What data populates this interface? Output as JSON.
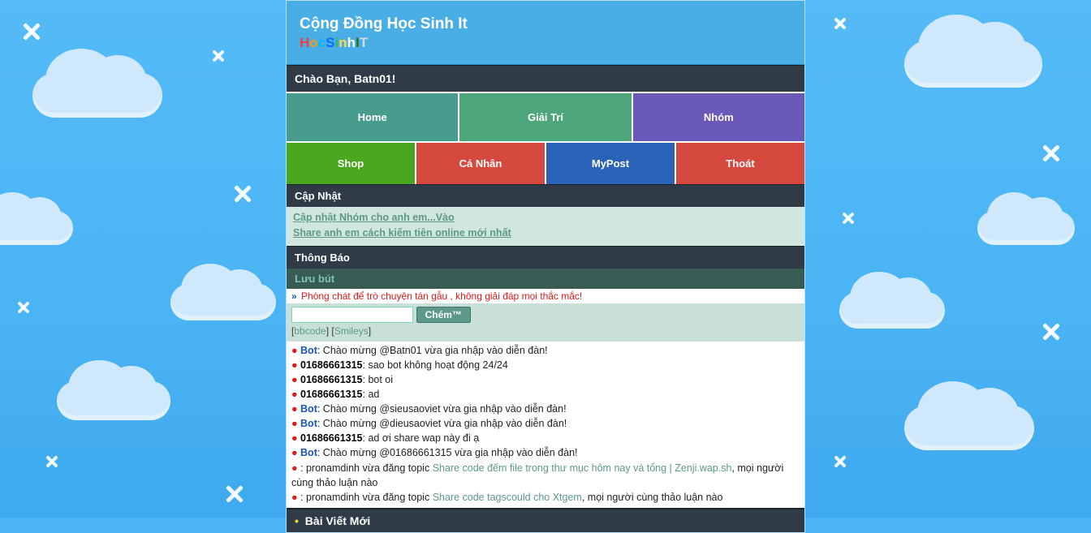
{
  "header": {
    "title": "Cộng Đồng Học Sinh It",
    "logo_chars": [
      "H",
      "o",
      "c",
      "S",
      "i",
      "n",
      "h",
      "I",
      "T"
    ]
  },
  "greeting_bar": "Chào Bạn, Batn01!",
  "nav_top": [
    {
      "label": "Home",
      "color": "bg-teal"
    },
    {
      "label": "Giải Trí",
      "color": "bg-green2"
    },
    {
      "label": "Nhóm",
      "color": "bg-purple"
    }
  ],
  "nav_bottom": [
    {
      "label": "Shop",
      "color": "bg-lime"
    },
    {
      "label": "Cá Nhân",
      "color": "bg-red"
    },
    {
      "label": "MyPost",
      "color": "bg-blue"
    },
    {
      "label": "Thoát",
      "color": "bg-red"
    }
  ],
  "update_section": {
    "title": "Cập Nhật",
    "links": [
      "Cập nhật Nhóm cho anh em...Vào",
      "Share anh em cách kiếm tiên online mới nhất"
    ]
  },
  "notice_title": "Thông Báo",
  "chat": {
    "subheader": "Lưu bút",
    "warning_arrow": "»",
    "warning_text": "Phòng chát để trò chuyện tán gẫu , không giải đáp mọi thắc mắc!",
    "send_button": "Chém™",
    "helper_bbcode": "bbcode",
    "helper_smileys": "Smileys",
    "input_value": ""
  },
  "chat_log": [
    {
      "user": "Bot",
      "kind": "bot",
      "text": "Chào mừng @Batn01 vừa gia nhập vào diễn đàn!"
    },
    {
      "user": "01686661315",
      "kind": "user",
      "text": "sao bot không hoạt động 24/24"
    },
    {
      "user": "01686661315",
      "kind": "user",
      "text": "bot oi"
    },
    {
      "user": "01686661315",
      "kind": "user",
      "text": "ad"
    },
    {
      "user": "Bot",
      "kind": "bot",
      "text": "Chào mừng @sieusaoviet vừa gia nhập vào diễn đàn!"
    },
    {
      "user": "Bot",
      "kind": "bot",
      "text": "Chào mừng @dieusaoviet vừa gia nhập vào diễn đàn!"
    },
    {
      "user": "01686661315",
      "kind": "user",
      "text": "ad ơi share wap này đi ạ"
    },
    {
      "user": "Bot",
      "kind": "bot",
      "text": "Chào mừng @01686661315 vừa gia nhập vào diễn đàn!"
    },
    {
      "user": "",
      "kind": "sys",
      "pre": "pronamdinh vừa đăng topic ",
      "link": "Share code đếm file trong thư mục hôm nay và tổng | Zenji.wap.sh",
      "post": ", mọi người cùng thảo luận nào"
    },
    {
      "user": "",
      "kind": "sys",
      "pre": "pronamdinh vừa đăng topic ",
      "link": "Share code tagscould cho Xtgem",
      "post": ", mọi người cùng thảo luận nào"
    }
  ],
  "posts_header": "Bài Viết Mới"
}
